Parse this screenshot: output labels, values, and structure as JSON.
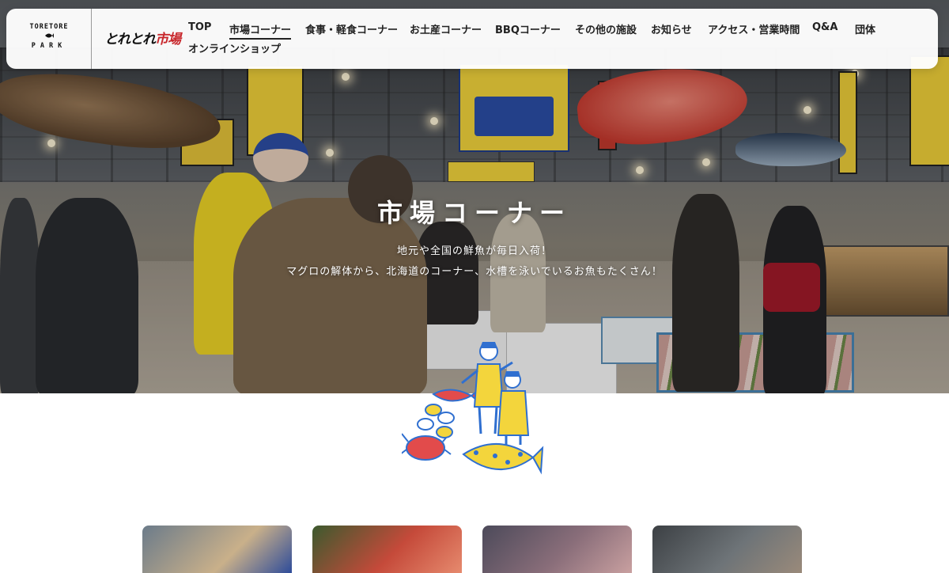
{
  "header": {
    "logo_top": "TORETORE",
    "logo_bottom": "PARK",
    "logo_script_black": "とれとれ",
    "logo_script_red": "市場"
  },
  "nav": {
    "items": [
      {
        "label": "TOP",
        "active": false
      },
      {
        "label": "市場コーナー",
        "active": true
      },
      {
        "label": "食事・軽食コーナー",
        "active": false
      },
      {
        "label": "お土産コーナー",
        "active": false
      },
      {
        "label": "BBQコーナー",
        "active": false
      },
      {
        "label": "その他の施設",
        "active": false
      },
      {
        "label": "お知らせ",
        "active": false
      },
      {
        "label": "アクセス・営業時間",
        "active": false
      },
      {
        "label": "Q&A",
        "active": false
      },
      {
        "label": "団体",
        "active": false
      },
      {
        "label": "オンラインショップ",
        "active": false
      }
    ]
  },
  "hero": {
    "title": "市場コーナー",
    "subtitle_line1": "地元や全国の鮮魚が毎日入荷！",
    "subtitle_line2": "マグロの解体から、北海道のコーナー、水槽を泳いでいるお魚もたくさん！"
  },
  "illustration": {
    "icon": "fishmonger-illustration-icon"
  },
  "cards": [
    {
      "name": "card-1",
      "color": "#5b6b7a"
    },
    {
      "name": "card-2",
      "color": "#b04a3a"
    },
    {
      "name": "card-3",
      "color": "#6a5a66"
    },
    {
      "name": "card-4",
      "color": "#4a4f52"
    }
  ],
  "colors": {
    "accent_red": "#c8282d",
    "illust_blue": "#2f6fd0",
    "illust_yellow": "#f3d53c"
  }
}
